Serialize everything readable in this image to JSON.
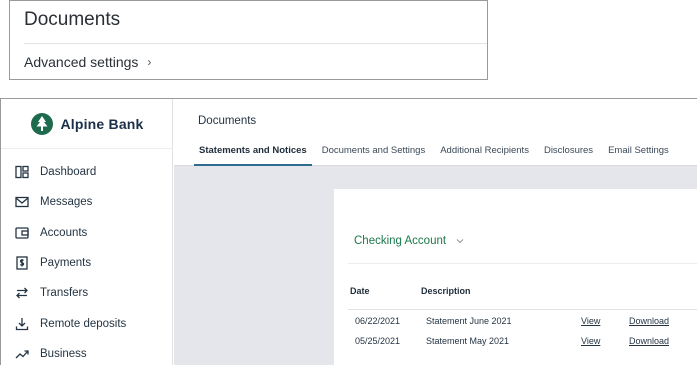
{
  "inset": {
    "title": "Documents",
    "advanced_settings": "Advanced settings",
    "chevron": "›"
  },
  "brand": {
    "name": "Alpine Bank",
    "color": "#1b3048",
    "logo_icon": "pine-tree-icon"
  },
  "sidebar": {
    "items": [
      {
        "label": "Dashboard",
        "icon": "dashboard-icon"
      },
      {
        "label": "Messages",
        "icon": "envelope-icon"
      },
      {
        "label": "Accounts",
        "icon": "wallet-icon"
      },
      {
        "label": "Payments",
        "icon": "dollar-doc-icon"
      },
      {
        "label": "Transfers",
        "icon": "transfer-arrows-icon"
      },
      {
        "label": "Remote deposits",
        "icon": "download-icon"
      },
      {
        "label": "Business",
        "icon": "trend-up-icon"
      }
    ]
  },
  "header": {
    "title": "Documents",
    "tabs": [
      {
        "label": "Statements and Notices",
        "active": true
      },
      {
        "label": "Documents and Settings",
        "active": false
      },
      {
        "label": "Additional Recipients",
        "active": false
      },
      {
        "label": "Disclosures",
        "active": false
      },
      {
        "label": "Email Settings",
        "active": false
      }
    ]
  },
  "account": {
    "selected": "Checking Account",
    "color": "#1a7a4a"
  },
  "table": {
    "headers": {
      "date": "Date",
      "description": "Description"
    },
    "rows": [
      {
        "date": "06/22/2021",
        "description": "Statement June 2021",
        "view": "View",
        "download": "Download"
      },
      {
        "date": "05/25/2021",
        "description": "Statement May 2021",
        "view": "View",
        "download": "Download"
      }
    ]
  },
  "colors": {
    "active_tab": "#2f6c8f",
    "main_bg": "#e4e6eb"
  }
}
